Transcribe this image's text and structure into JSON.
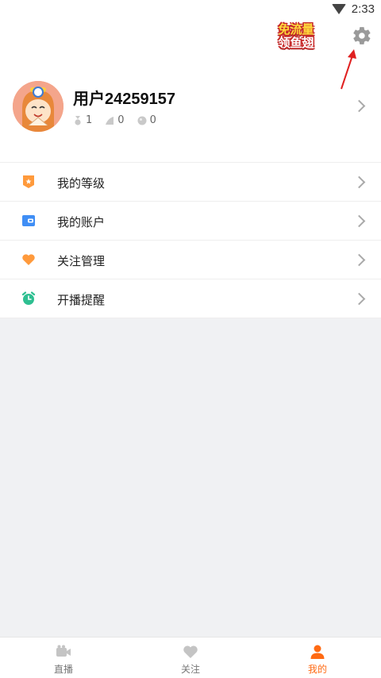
{
  "status_bar": {
    "time": "2:33",
    "wifi_icon": "wifi-icon"
  },
  "header": {
    "promo_line1": "免流量",
    "promo_line2": "领鱼翅",
    "settings_icon": "gear-icon"
  },
  "profile": {
    "username": "用户24259157",
    "stats": [
      {
        "icon": "medal-icon",
        "value": "1"
      },
      {
        "icon": "fin-icon",
        "value": "0"
      },
      {
        "icon": "ball-icon",
        "value": "0"
      }
    ]
  },
  "menu": [
    {
      "label": "我的等级",
      "icon": "level-badge-icon",
      "color": "#ff9a3c"
    },
    {
      "label": "我的账户",
      "icon": "wallet-icon",
      "color": "#3f8ef5"
    },
    {
      "label": "关注管理",
      "icon": "heart-icon",
      "color": "#ff9a3c"
    },
    {
      "label": "开播提醒",
      "icon": "alarm-clock-icon",
      "color": "#2ebf91"
    }
  ],
  "bottom_nav": [
    {
      "label": "直播",
      "icon": "video-icon",
      "active": false
    },
    {
      "label": "关注",
      "icon": "heart-icon",
      "active": false
    },
    {
      "label": "我的",
      "icon": "person-icon",
      "active": true
    }
  ],
  "colors": {
    "accent": "#ff6a13",
    "background": "#f0f1f3"
  }
}
